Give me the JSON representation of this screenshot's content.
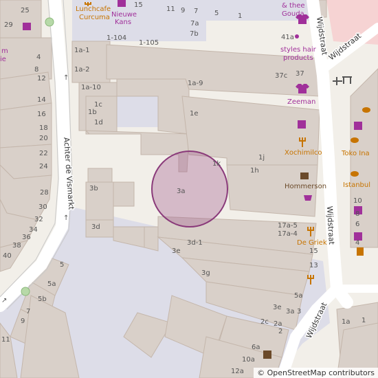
{
  "map": {
    "streets": {
      "achter_de_vismarkt": "Achter de Vismarkt",
      "wijdstraat_top": "Wijdstraat",
      "wijdstraat_right": "Wijdstraat",
      "wijdstraat_ne": "Wijdstraat",
      "wijdstraat_bottom": "Wijdstraat"
    },
    "pois": {
      "lunchcafe_1": "Lunchcafe",
      "lunchcafe_2": "Curcuma",
      "nieuwe_kans_1": "Nieuwe",
      "nieuwe_kans_2": "Kans",
      "thee_gouda_1": "& thee",
      "thee_gouda_2": "Gouda",
      "styles_1": "styles hair",
      "styles_2": "products",
      "zeeman": "Zeeman",
      "xochimilco": "Xochimilco",
      "hommerson": "Hommerson",
      "de_griek": "De Griek",
      "toko_ina": "Toko Ina",
      "istanbul": "Istanbul",
      "left_m": "m",
      "left_ie": "ie"
    },
    "house_numbers": {
      "n25": "25",
      "n15": "15",
      "n11": "11",
      "n9": "9",
      "n7": "7",
      "n5": "5",
      "n1": "1",
      "n29": "29",
      "n1_104": "1-104",
      "n7a": "7a",
      "n41a": "41a",
      "n7b": "7b",
      "n1_105": "1-105",
      "n4": "4",
      "n1a_1": "1a-1",
      "n8": "8",
      "n1a_2": "1a-2",
      "n37c": "37c",
      "n37": "37",
      "n12": "12",
      "n1a_10": "1a-10",
      "n14": "14",
      "n1a_9": "1a-9",
      "n1c": "1c",
      "n16": "16",
      "n1b": "1b",
      "n1e": "1e",
      "n18": "18",
      "n1d": "1d",
      "n20": "20",
      "n22": "22",
      "n1j": "1j",
      "n24": "24",
      "n1k": "1k",
      "n1h": "1h",
      "n28": "28",
      "n3b": "3b",
      "n3a": "3a",
      "n30": "30",
      "n32": "32",
      "n34": "34",
      "n3d": "3d",
      "n36": "36",
      "n38": "38",
      "n40": "40",
      "n17a_5": "17a-5",
      "n17a_4": "17a-4",
      "n3d_1": "3d-1",
      "n3e": "3e",
      "n15b": "15",
      "n13": "13",
      "n3g": "3g",
      "n5_left": "5",
      "n5a": "5a",
      "n5a_r": "5a",
      "n5b": "5b",
      "n3e_r": "3e",
      "n3a_r": "3a",
      "n3_r": "3",
      "n7_left": "7",
      "n9_left": "9",
      "n2c": "2c",
      "n2a": "2a",
      "n2": "2",
      "n11_left": "11",
      "n6a": "6a",
      "n10a": "10a",
      "n12a": "12a",
      "n1a_r": "1a",
      "n1_r": "1",
      "n10": "10",
      "n8r": "8",
      "n6r": "6",
      "n4r": "4"
    },
    "attribution": "© OpenStreetMap contributors",
    "colors": {
      "background": "#f2efe9",
      "building": "#d9d0c9",
      "building_stroke": "#c4b6ab",
      "road": "#ffffff",
      "pedestrian": "#dddde8",
      "poi_purple": "#a0309a",
      "poi_orange": "#c77400",
      "marker_fill": "#a05a8c",
      "park": "#f6d3d3"
    }
  }
}
